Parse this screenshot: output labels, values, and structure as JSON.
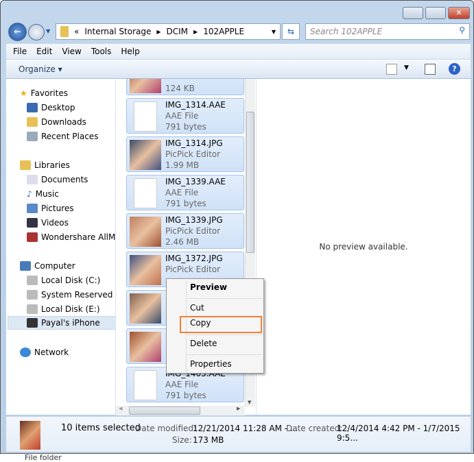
{
  "address": {
    "overflow": "«",
    "crumbs": [
      "Internal Storage",
      "DCIM",
      "102APPLE"
    ]
  },
  "search": {
    "placeholder": "Search 102APPLE"
  },
  "menu": [
    "File",
    "Edit",
    "View",
    "Tools",
    "Help"
  ],
  "toolbar": {
    "organize": "Organize ▾"
  },
  "nav": {
    "favorites": "Favorites",
    "desktop": "Desktop",
    "downloads": "Downloads",
    "recent": "Recent Places",
    "libraries": "Libraries",
    "documents": "Documents",
    "music": "Music",
    "pictures": "Pictures",
    "videos": "Videos",
    "wondershare": "Wondershare AllMy",
    "computer": "Computer",
    "c": "Local Disk (C:)",
    "sys": "System Reserved (D:",
    "e": "Local Disk (E:)",
    "iphone": "Payal's iPhone",
    "network": "Network"
  },
  "files": [
    {
      "name": "",
      "type": "",
      "size": "124 KB",
      "thumb": "photo"
    },
    {
      "name": "IMG_1314.AAE",
      "type": "AAE File",
      "size": "791 bytes",
      "thumb": "doc"
    },
    {
      "name": "IMG_1314.JPG",
      "type": "PicPick Editor",
      "size": "1.99 MB",
      "thumb": "photo"
    },
    {
      "name": "IMG_1339.AAE",
      "type": "AAE File",
      "size": "791 bytes",
      "thumb": "doc"
    },
    {
      "name": "IMG_1339.JPG",
      "type": "PicPick Editor",
      "size": "2.46 MB",
      "thumb": "photo"
    },
    {
      "name": "IMG_1372.JPG",
      "type": "PicPick Editor",
      "size": "",
      "thumb": "photo"
    },
    {
      "name": "",
      "type": "",
      "size": "",
      "thumb": "photo"
    },
    {
      "name": "",
      "type": "",
      "size": "",
      "thumb": "photo"
    },
    {
      "name": "IMG_1405.AAE",
      "type": "AAE File",
      "size": "791 bytes",
      "thumb": "doc"
    }
  ],
  "preview": {
    "text": "No preview available."
  },
  "context_menu": {
    "preview": "Preview",
    "cut": "Cut",
    "copy": "Copy",
    "delete": "Delete",
    "properties": "Properties",
    "highlight_color": "#f08030"
  },
  "status": {
    "count": "10 items selected",
    "modified_label": "Date modified:",
    "modified": "12/21/2014 11:28 AM - ...",
    "created_label": "Date created:",
    "created": "12/4/2014 4:42 PM - 1/7/2015 9:5...",
    "size_label": "Size:",
    "size": "173 MB"
  },
  "below": "File folder"
}
